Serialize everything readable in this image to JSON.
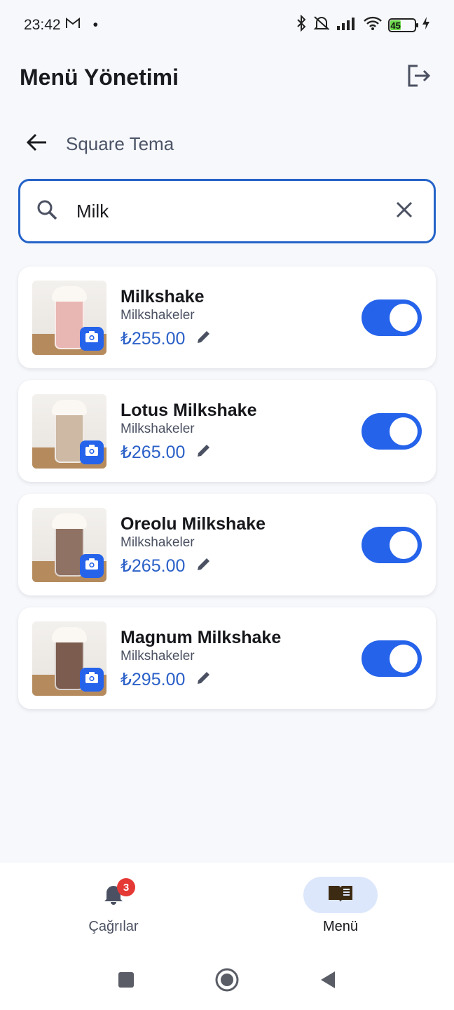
{
  "status_bar": {
    "time": "23:42",
    "mail_icon": "gmail-icon",
    "dot": "•",
    "battery_level": "45"
  },
  "header": {
    "title": "Menü Yönetimi",
    "logout_icon": "logout-icon"
  },
  "sub_header": {
    "title": "Square Tema",
    "back_icon": "arrow-left-icon"
  },
  "search": {
    "value": "Milk",
    "search_icon": "search-icon",
    "clear_icon": "close-icon"
  },
  "products": [
    {
      "name": "Milkshake",
      "category": "Milkshakeler",
      "price": "₺255.00",
      "enabled": true,
      "drink_color": "#e9b7b3"
    },
    {
      "name": "Lotus Milkshake",
      "category": "Milkshakeler",
      "price": "₺265.00",
      "enabled": true,
      "drink_color": "#cdb9a4"
    },
    {
      "name": "Oreolu Milkshake",
      "category": "Milkshakeler",
      "price": "₺265.00",
      "enabled": true,
      "drink_color": "#8f7264"
    },
    {
      "name": "Magnum Milkshake",
      "category": "Milkshakeler",
      "price": "₺295.00",
      "enabled": true,
      "drink_color": "#7b5c4e"
    }
  ],
  "bottom_nav": {
    "items": [
      {
        "label": "Çağrılar",
        "icon": "bell-icon",
        "badge": "3",
        "active": false
      },
      {
        "label": "Menü",
        "icon": "menu-book-icon",
        "active": true
      }
    ]
  },
  "colors": {
    "accent": "#2563eb",
    "price": "#2b60c8",
    "badge": "#e53935"
  }
}
